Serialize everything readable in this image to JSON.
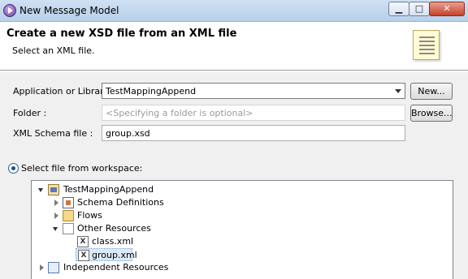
{
  "window": {
    "title": "New Message Model",
    "minimize_glyph": "▁",
    "maximize_glyph": "□",
    "close_glyph": "✕"
  },
  "banner": {
    "title": "Create a new XSD file from an XML file",
    "subtitle": "Select an XML file."
  },
  "form": {
    "app_label": "Application or Library:",
    "app_value": "TestMappingAppend",
    "new_button": "New...",
    "folder_label": "Folder :",
    "folder_placeholder": "<Specifying a folder is optional>",
    "browse_button": "Browse...",
    "schema_label": "XML Schema file :",
    "schema_value": "group.xsd"
  },
  "source": {
    "radio_label": "Select file from workspace:"
  },
  "tree": {
    "project": "TestMappingAppend",
    "schema_definitions": "Schema Definitions",
    "flows": "Flows",
    "other_resources": "Other Resources",
    "class_xml": "class.xml",
    "group_xml": "group.xml",
    "independent_resources": "Independent Resources",
    "file_glyph": "X"
  }
}
